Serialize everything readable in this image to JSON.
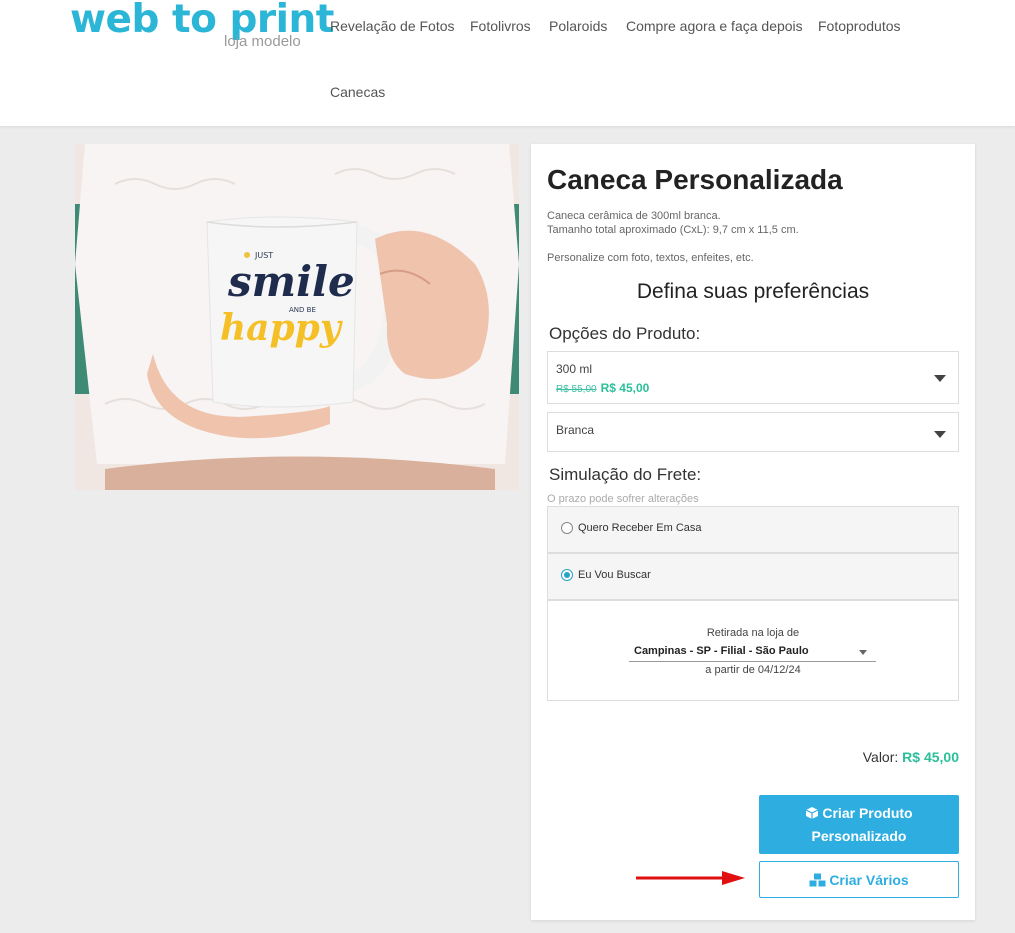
{
  "header": {
    "logo_main": "web to print",
    "logo_sub": "loja modelo",
    "nav": [
      "Revelação de Fotos",
      "Fotolivros",
      "Polaroids",
      "Compre agora e faça depois",
      "Fotoprodutos",
      "Canecas"
    ]
  },
  "product": {
    "image_text": {
      "just": "JUST",
      "smile": "smile",
      "and_be": "AND BE",
      "happy": "happy"
    },
    "title": "Caneca Personalizada",
    "description": [
      "Caneca cerâmica de 300ml branca.",
      "Tamanho total aproximado (CxL): 9,7 cm x 11,5 cm.",
      "Personalize com foto, textos, enfeites, etc."
    ],
    "preferences_heading": "Defina suas preferências",
    "options_label": "Opções do Produto:",
    "size_select": {
      "value": "300 ml",
      "old_price": "R$ 55,00",
      "new_price": "R$ 45,00"
    },
    "color_select": {
      "value": "Branca"
    },
    "shipping_label": "Simulação do Frete:",
    "shipping_note": "O prazo pode sofrer alterações",
    "shipping_options": [
      {
        "label": "Quero Receber Em Casa",
        "checked": false
      },
      {
        "label": "Eu Vou Buscar",
        "checked": true
      }
    ],
    "pickup": {
      "intro": "Retirada na loja de",
      "store": "Campinas - SP - Filial - São Paulo",
      "date": "a partir de 04/12/24"
    },
    "total_label": "Valor:",
    "total_value": "R$ 45,00",
    "buttons": {
      "create_line1": "Criar Produto",
      "create_line2": "Personalizado",
      "create_many": "Criar Vários"
    }
  },
  "colors": {
    "accent": "#2eaee0",
    "price": "#2bbf9a",
    "annotation_arrow": "#e01010"
  }
}
